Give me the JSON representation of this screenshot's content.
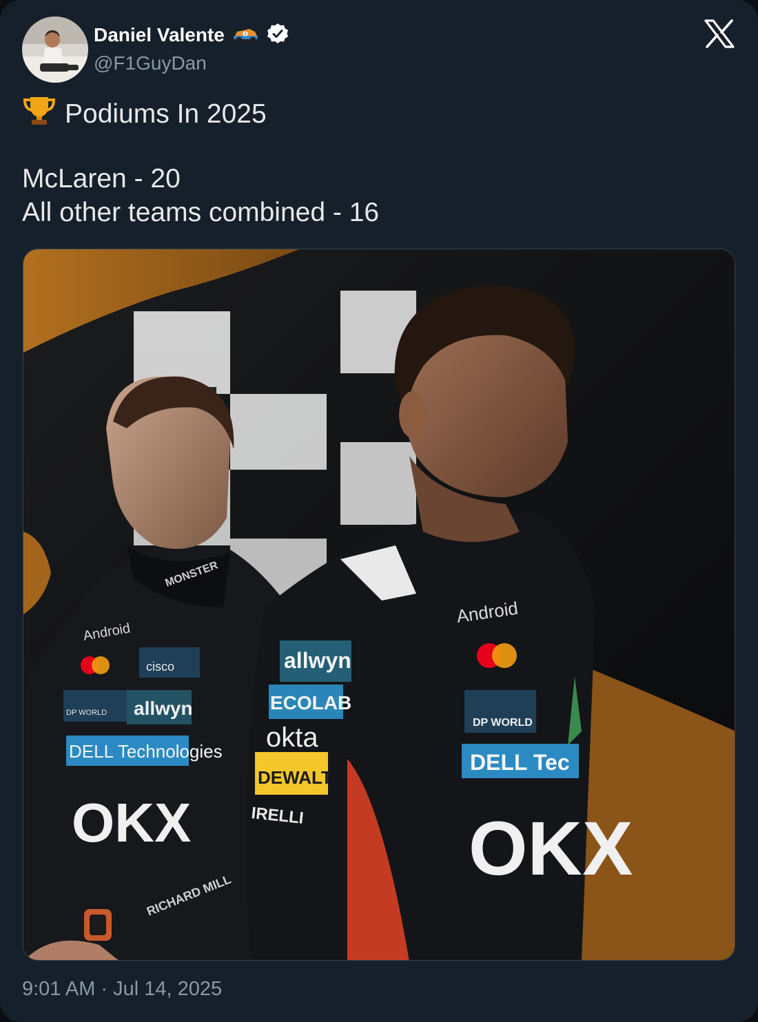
{
  "author": {
    "display_name": "Daniel Valente",
    "handle": "@F1GuyDan",
    "verified": true,
    "name_emoji": "race-car-emoji",
    "avatar": "avatar-photo"
  },
  "platform": {
    "logo": "x-logo-icon"
  },
  "tweet": {
    "lines": [
      "Podiums In 2025",
      "",
      "McLaren - 20",
      "All other teams combined - 16"
    ],
    "lead_emoji": "trophy-emoji"
  },
  "media": {
    "description_icon": "photo",
    "sponsor_labels": {
      "allwyn": "allwyn",
      "ecolab": "ECOLAB",
      "okta": "okta",
      "dewalt": "DEWALT",
      "pirelli": "IRELLI",
      "android": "Android",
      "dp_world": "DP WORLD",
      "dell": "DELL Tec",
      "cisco": "cisco",
      "dell_left": "DELL Technologies",
      "okx": "OKX",
      "richard_mille": "RICHARD MILL",
      "monster": "MONSTER"
    }
  },
  "meta": {
    "time": "9:01 AM",
    "separator": "·",
    "date": "Jul 14, 2025"
  },
  "colors": {
    "background": "#15202b",
    "text": "#e7e9ea",
    "secondary": "#8b98a5",
    "papaya": "#e8902a"
  }
}
